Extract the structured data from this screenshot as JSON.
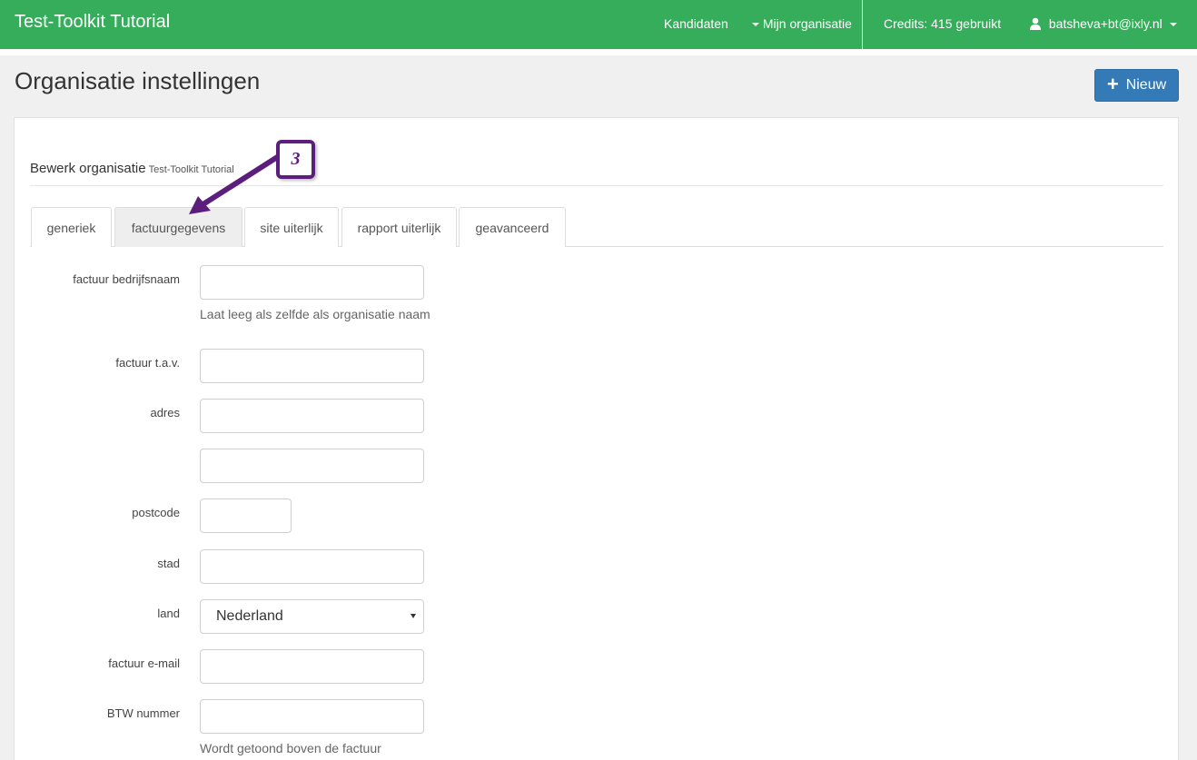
{
  "navbar": {
    "brand": "Test-Toolkit Tutorial",
    "links": [
      {
        "label": "Kandidaten"
      },
      {
        "label": "Mijn organisatie"
      }
    ],
    "credits": "Credits: 415 gebruikt",
    "user": "batsheva+bt@ixly.nl",
    "color": "#35ad5a"
  },
  "page": {
    "title": "Organisatie instellingen",
    "new_button": "Nieuw"
  },
  "panel": {
    "heading": "Bewerk organisatie",
    "heading_sub": "Test-Toolkit Tutorial"
  },
  "tabs": [
    {
      "label": "generiek"
    },
    {
      "label": "factuurgegevens",
      "active": true
    },
    {
      "label": "site uiterlijk"
    },
    {
      "label": "rapport uiterlijk"
    },
    {
      "label": "geavanceerd"
    }
  ],
  "form": {
    "company_name_label": "factuur bedrijfsnaam",
    "company_name_help": "Laat leeg als zelfde als organisatie naam",
    "attn_label": "factuur t.a.v.",
    "address_label": "adres",
    "postcode_label": "postcode",
    "city_label": "stad",
    "country_label": "land",
    "country_value": "Nederland",
    "email_label": "factuur e-mail",
    "vat_label": "BTW nummer",
    "vat_help": "Wordt getoond boven de factuur"
  },
  "callout": {
    "number": "3",
    "color": "#5c1e7d"
  }
}
